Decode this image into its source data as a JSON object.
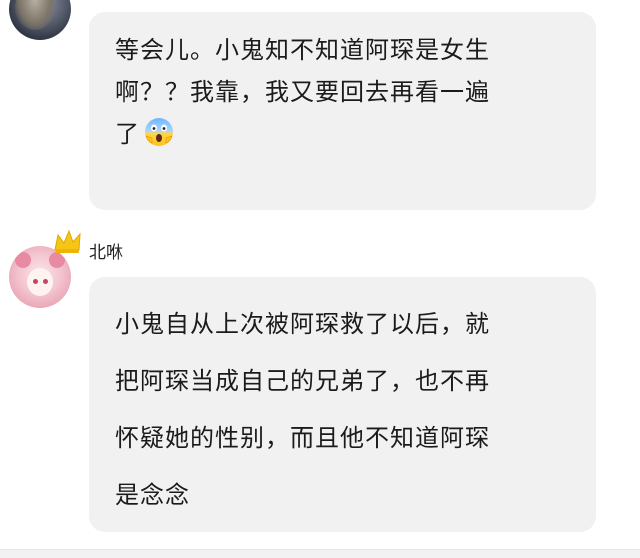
{
  "messages": [
    {
      "lines": [
        "等会儿。小鬼知不知道阿琛是女生",
        "啊？？我靠，我又要回去再看一遍",
        "了"
      ],
      "trailing_emoji": "screaming-face-emoji"
    },
    {
      "username": "北咻",
      "badge_icon": "crown-icon",
      "lines": [
        "小鬼自从上次被阿琛救了以后，就",
        "把阿琛当成自己的兄弟了，也不再",
        "怀疑她的性别，而且他不知道阿琛",
        "是念念"
      ]
    }
  ],
  "colors": {
    "bubble": "#f1f1f1",
    "text": "#1b1b1b",
    "crown": "#f5c518"
  }
}
